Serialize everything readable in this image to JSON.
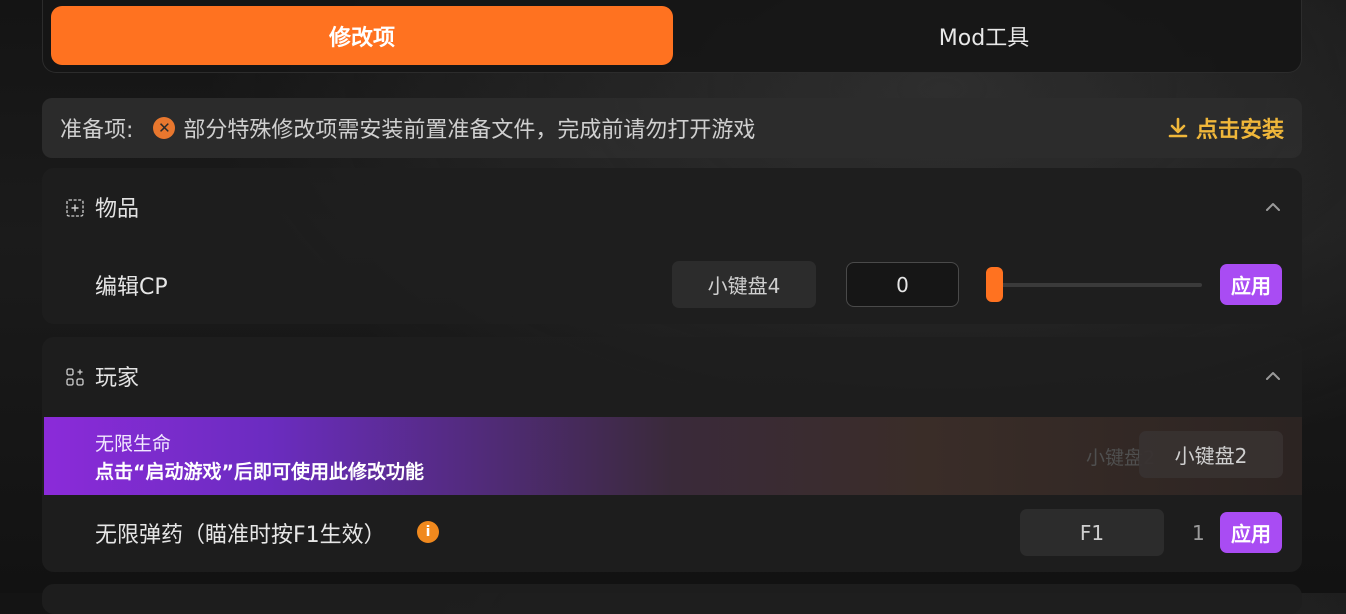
{
  "tabs": {
    "active_label": "修改项",
    "inactive_label": "Mod工具"
  },
  "prep": {
    "label": "准备项:",
    "message": "部分特殊修改项需安装前置准备文件，完成前请勿打开游戏",
    "install_label": "点击安装",
    "status_icon": "x-circle-icon",
    "accent": "#f0b73a"
  },
  "items_section": {
    "title": "物品",
    "rows": [
      {
        "label": "编辑CP",
        "hotkey": "小键盘4",
        "value": "0",
        "slider_value": 0,
        "apply_label": "应用"
      }
    ]
  },
  "player_section": {
    "title": "玩家",
    "highlight": {
      "title": "无限生命",
      "subtitle": "点击“启动游戏”后即可使用此修改功能",
      "ghost_hotkey": "小键盘2",
      "hotkey": "小键盘2"
    },
    "rows": [
      {
        "label": "无限弹药（瞄准时按F1生效）",
        "hotkey": "F1",
        "count": "1",
        "apply_label": "应用"
      }
    ]
  },
  "colors": {
    "accent_orange": "#ff7220",
    "apply_purple": "#a94cf3",
    "install_gold": "#f0b73a"
  }
}
